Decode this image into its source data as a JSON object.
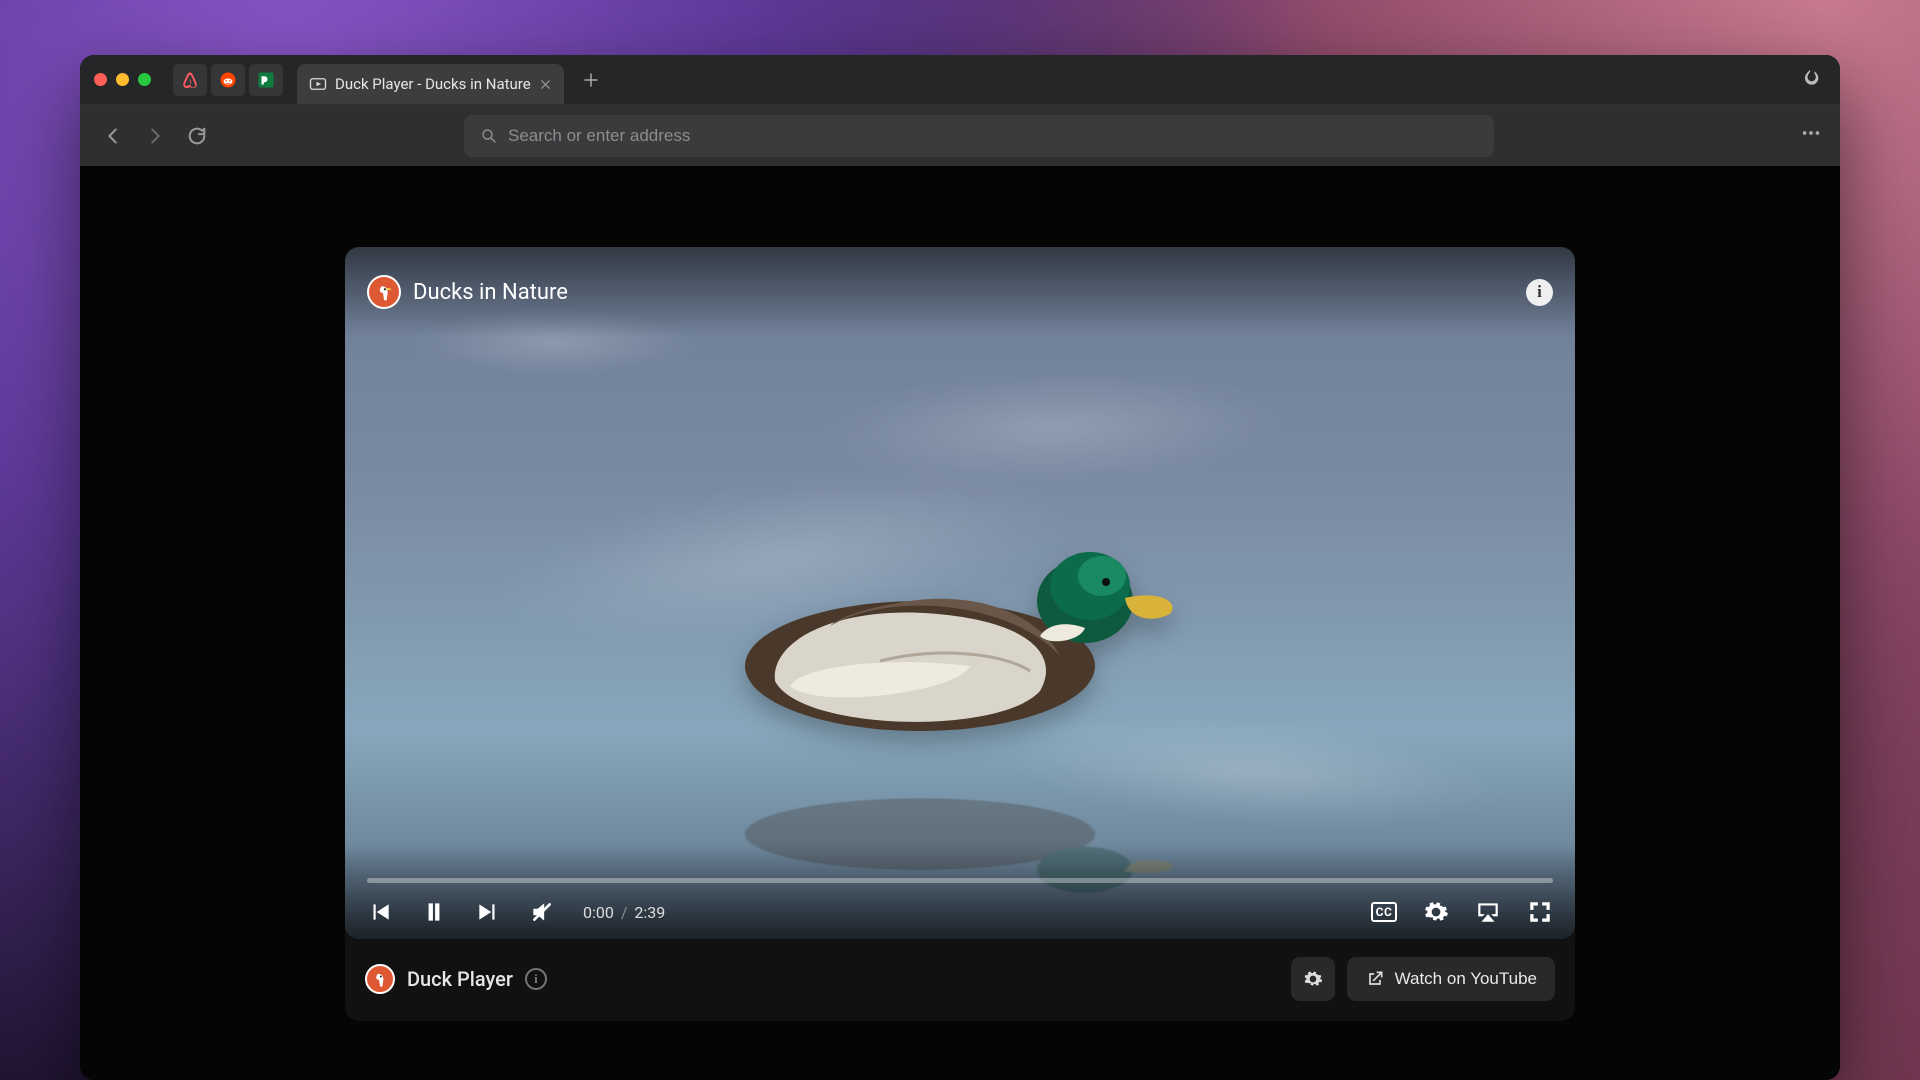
{
  "window": {
    "pinned_icons": [
      "airbnb",
      "reddit",
      "pied-piper"
    ],
    "tab": {
      "title": "Duck Player - Ducks in Nature"
    },
    "address_placeholder": "Search or enter address"
  },
  "video": {
    "title": "Ducks in Nature",
    "current_time": "0:00",
    "duration": "2:39",
    "progress_pct": 0,
    "cc_label": "CC"
  },
  "footer": {
    "player_name": "Duck Player",
    "watch_label": "Watch on YouTube"
  },
  "colors": {
    "accent": "#de5833",
    "tab_bg": "#3c3d3f",
    "toolbar_bg": "#2e2f31"
  }
}
